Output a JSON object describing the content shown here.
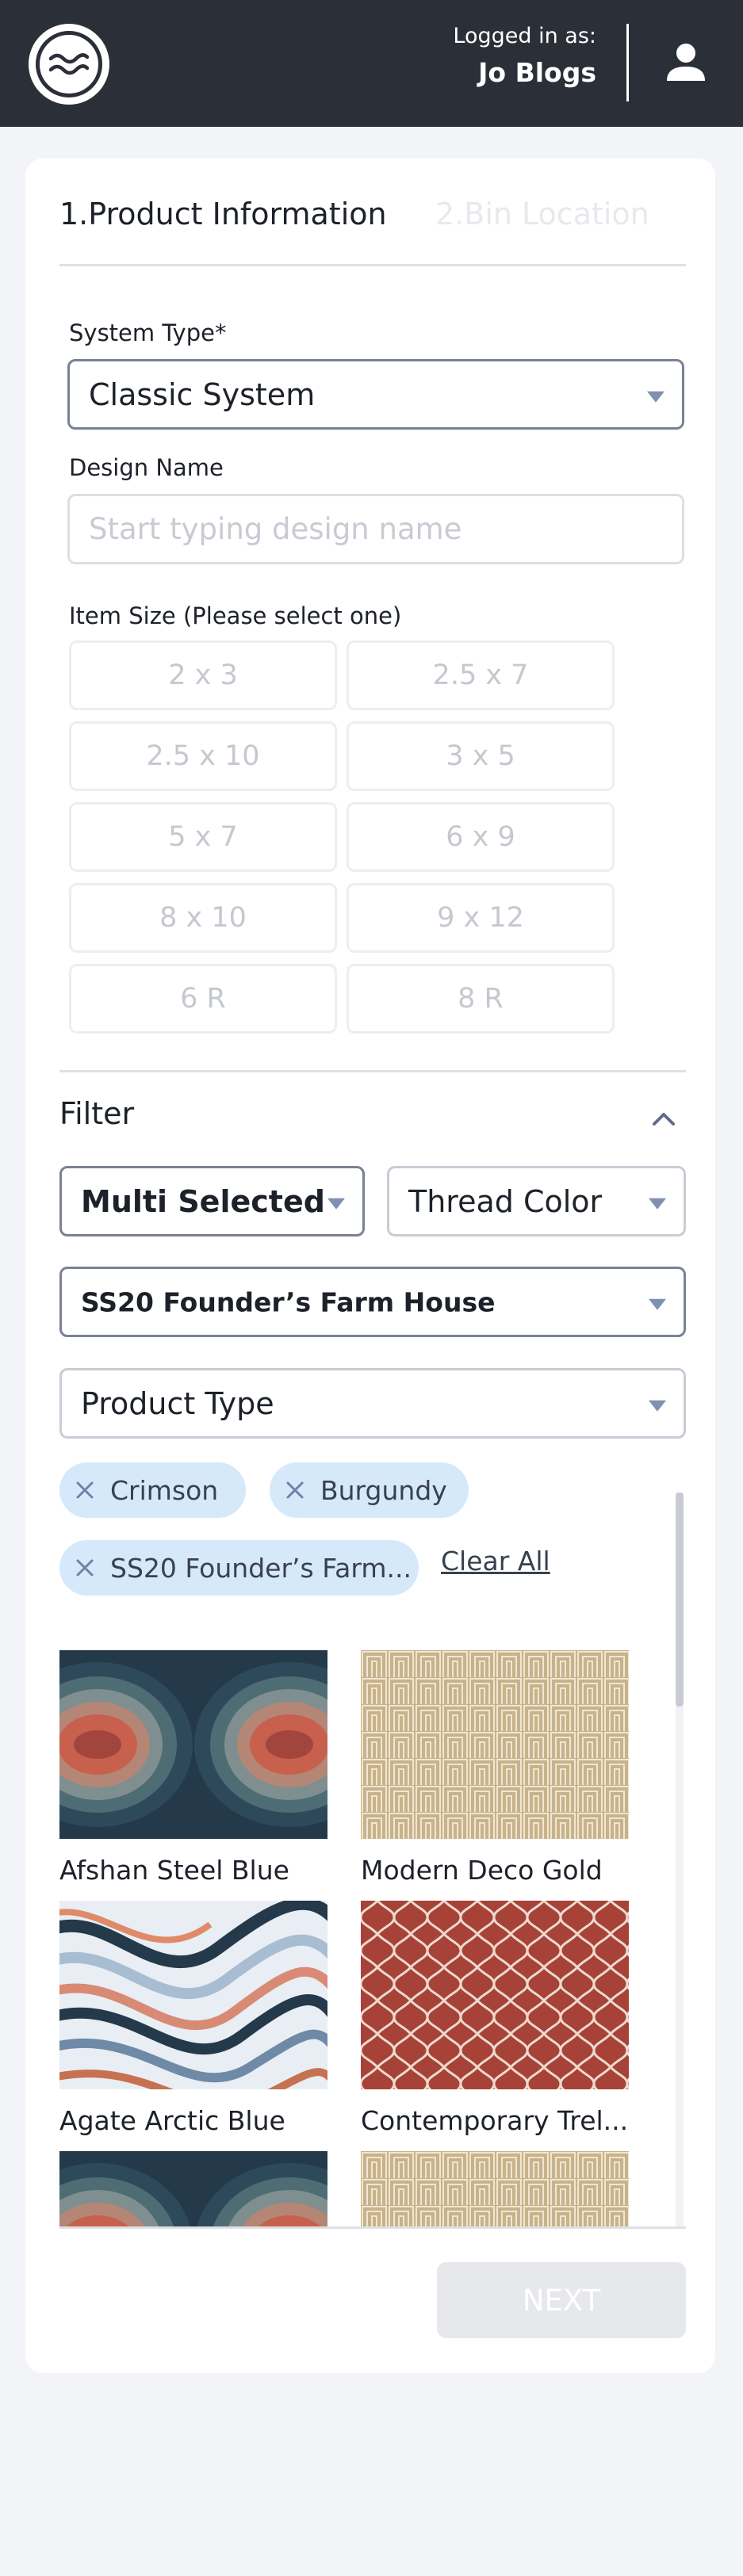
{
  "header": {
    "logged_in_label": "Logged in as:",
    "user_name": "Jo Blogs"
  },
  "steps": [
    {
      "label": "1.Product Information"
    },
    {
      "label": "2.Bin Location"
    }
  ],
  "form": {
    "system_type": {
      "label": "System Type*",
      "value": "Classic System"
    },
    "design_name": {
      "label": "Design Name",
      "placeholder": "Start typing design name",
      "value": ""
    },
    "item_size": {
      "label": "Item Size (Please select one)",
      "options": [
        "2 x 3",
        "2.5 x 7",
        "2.5 x 10",
        "3 x 5",
        "5 x 7",
        "6 x 9",
        "8 x 10",
        "9 x 12",
        "6 R",
        "8 R"
      ]
    }
  },
  "filter": {
    "title": "Filter",
    "multi_select": "Multi Selected",
    "thread_color": "Thread Color",
    "collection": "SS20 Founder’s Farm House",
    "product_type": "Product Type",
    "chips": [
      "Crimson",
      "Burgundy",
      "SS20 Founder’s Farm..."
    ],
    "clear_all": "Clear All"
  },
  "results": [
    {
      "name": "Afshan Steel Blue",
      "pattern": "afshan"
    },
    {
      "name": "Modern Deco Gold",
      "pattern": "deco"
    },
    {
      "name": "Agate Arctic Blue",
      "pattern": "agate"
    },
    {
      "name": "Contemporary Trel...",
      "pattern": "trellis"
    },
    {
      "name": "",
      "pattern": "afshan"
    },
    {
      "name": "",
      "pattern": "deco"
    }
  ],
  "actions": {
    "next": "NEXT"
  },
  "colors": {
    "header_bg": "#2b2f38",
    "chip_bg": "#d6e9fb",
    "caret": "#7d92b0",
    "disabled_button": "#e6e8ec"
  }
}
